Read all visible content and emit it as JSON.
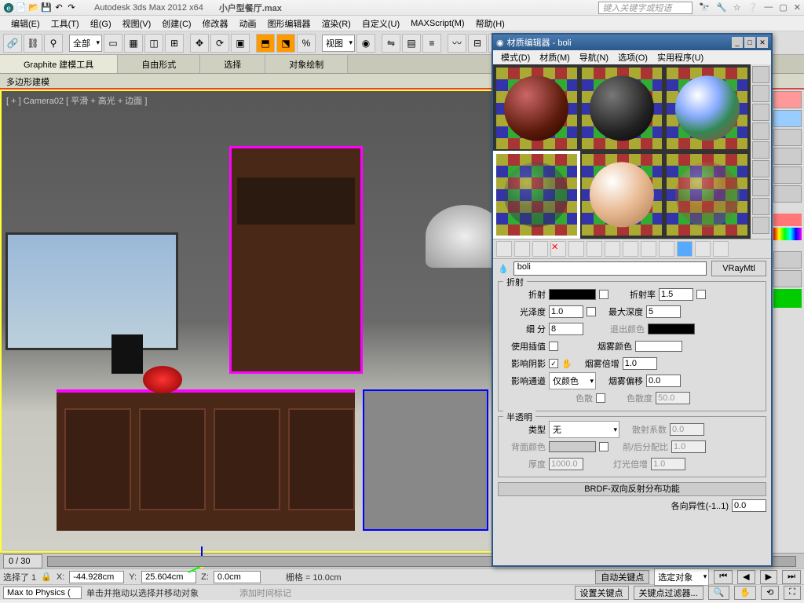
{
  "titlebar": {
    "app": "Autodesk 3ds Max  2012 x64",
    "file": "小户型餐厅.max",
    "search_placeholder": "键入关键字或短语"
  },
  "menubar": [
    "编辑(E)",
    "工具(T)",
    "组(G)",
    "视图(V)",
    "创建(C)",
    "修改器",
    "动画",
    "图形编辑器",
    "渲染(R)",
    "自定义(U)",
    "MAXScript(M)",
    "帮助(H)"
  ],
  "toolbar": {
    "dropdown_all": "全部",
    "dropdown_view": "视图"
  },
  "ribbon": {
    "tabs": [
      "Graphite 建模工具",
      "自由形式",
      "选择",
      "对象绘制"
    ],
    "sub": "多边形建模"
  },
  "viewport": {
    "label": "[ + ] Camera02 [ 平滑 + 高光 + 边面 ]"
  },
  "material_editor": {
    "title": "材质编辑器 - boli",
    "menu": [
      "模式(D)",
      "材质(M)",
      "导航(N)",
      "选项(O)",
      "实用程序(U)"
    ],
    "name": "boli",
    "type": "VRayMtl",
    "groups": {
      "refraction": {
        "title": "折射",
        "refract": "折射",
        "ior_lbl": "折射率",
        "ior": "1.5",
        "gloss_lbl": "光泽度",
        "gloss": "1.0",
        "maxdepth_lbl": "最大深度",
        "maxdepth": "5",
        "subdiv_lbl": "细 分",
        "subdiv": "8",
        "exitcolor_lbl": "退出颜色",
        "interp_lbl": "使用插值",
        "fogcolor_lbl": "烟雾颜色",
        "shadow_lbl": "影响阴影",
        "fogmult_lbl": "烟雾倍增",
        "fogmult": "1.0",
        "channel_lbl": "影响通道",
        "channel": "仅颜色",
        "fogbias_lbl": "烟雾偏移",
        "fogbias": "0.0",
        "disp_lbl": "色散",
        "dispval_lbl": "色散度",
        "dispval": "50.0"
      },
      "translucency": {
        "title": "半透明",
        "type_lbl": "类型",
        "type": "无",
        "scatter_lbl": "散射系数",
        "scatter": "0.0",
        "back_lbl": "背面颜色",
        "fb_lbl": "前/后分配比",
        "fb": "1.0",
        "thick_lbl": "厚度",
        "thick": "1000.0",
        "lightmult_lbl": "灯光倍增",
        "lightmult": "1.0"
      },
      "brdf": "BRDF-双向反射分布功能",
      "aniso_lbl": "各向异性(-1..1)",
      "aniso": "0.0"
    }
  },
  "timeline": {
    "frame": "0 / 30"
  },
  "status": {
    "sel_label": "选择了 1",
    "sel_icon": "🔒",
    "x_lbl": "X:",
    "x": "-44.928cm",
    "y_lbl": "Y:",
    "y": "25.604cm",
    "z_lbl": "Z:",
    "z": "0.0cm",
    "grid": "栅格 = 10.0cm",
    "autokey": "自动关键点",
    "autosel": "选定对象",
    "maxscript": "Max to Physics (",
    "hint": "单击并拖动以选择并移动对象",
    "addtime": "添加时间标记",
    "setkey": "设置关键点",
    "keyfilter": "关键点过滤器..."
  }
}
